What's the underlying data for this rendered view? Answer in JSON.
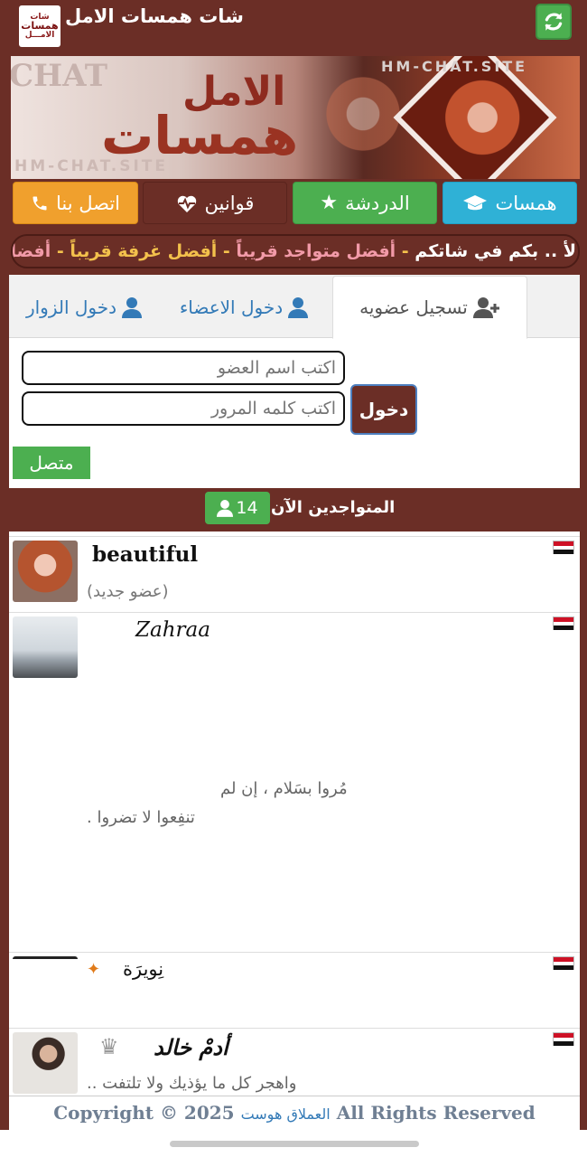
{
  "app": {
    "title": "شات همسات الامل",
    "logo_line1": "شات",
    "logo_line2": "همسات",
    "logo_line3": "الامـــل"
  },
  "banner": {
    "chat_word": "CHAT",
    "site_top": "HM-CHAT.SITE",
    "site_bottom": "HM-CHAT.SITE",
    "name_line1": "الامل",
    "name_line2": "همسات"
  },
  "nav": {
    "contact": "اتصل بنا",
    "rules": "قوانين",
    "chat": "الدردشة",
    "whispers": "همسات"
  },
  "marquee": {
    "part1": "لأ .. بكم في شاتكم",
    "sep1": " - ",
    "part2": "أفضل متواجد قريباً",
    "sep2": " - ",
    "part3": "أفضل غرفة قريباً",
    "sep3": " - ",
    "part4": "أفضل"
  },
  "tabs": {
    "register": "تسجيل عضويه",
    "members": "دخول الاعضاء",
    "guests": "دخول الزوار"
  },
  "login": {
    "username_placeholder": "اكتب اسم العضو",
    "password_placeholder": "اكتب كلمه المرور",
    "submit": "دخول",
    "online_button": "متصل"
  },
  "online": {
    "title": "المتواجدين الآن",
    "count": "14"
  },
  "users": [
    {
      "name": "beautiful",
      "status": "(عضو جديد)"
    },
    {
      "name": "Zahraa",
      "bio_line1": "مُروا بسَلام ، إن لم",
      "bio_line2": ". تنفِعوا لا تضروا"
    },
    {
      "name": "نِويرَة"
    },
    {
      "name": "أدمْ خالد",
      "bio": ".. واهجر كل ما يؤذيك ولا تلتفت"
    }
  ],
  "footer": {
    "copyright": "Copyright © 2025",
    "brand": "العملاق هوست",
    "rights": "All Rights Reserved"
  },
  "colors": {
    "primary": "#6b2e26",
    "green": "#4caf50",
    "orange": "#f0a02d",
    "cyan": "#2fb1d6",
    "link": "#337ab7"
  }
}
